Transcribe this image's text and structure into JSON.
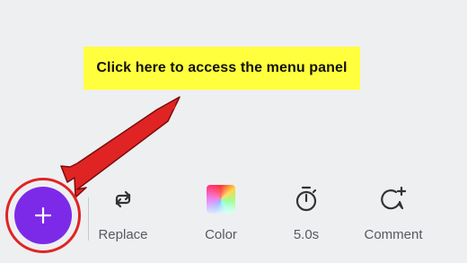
{
  "callout": {
    "text": "Click here to access the menu panel",
    "background": "#ffff3d"
  },
  "colors": {
    "accent": "#7d2ae8",
    "annotation_red": "#e02424",
    "background": "#eeeff1"
  },
  "add_button": {
    "icon": "plus-icon"
  },
  "toolbar": {
    "items": [
      {
        "label": "Replace",
        "icon": "replace-icon"
      },
      {
        "label": "Color",
        "icon": "color-swatch-icon"
      },
      {
        "label": "5.0s",
        "icon": "timer-icon"
      },
      {
        "label": "Comment",
        "icon": "comment-add-icon"
      }
    ]
  }
}
